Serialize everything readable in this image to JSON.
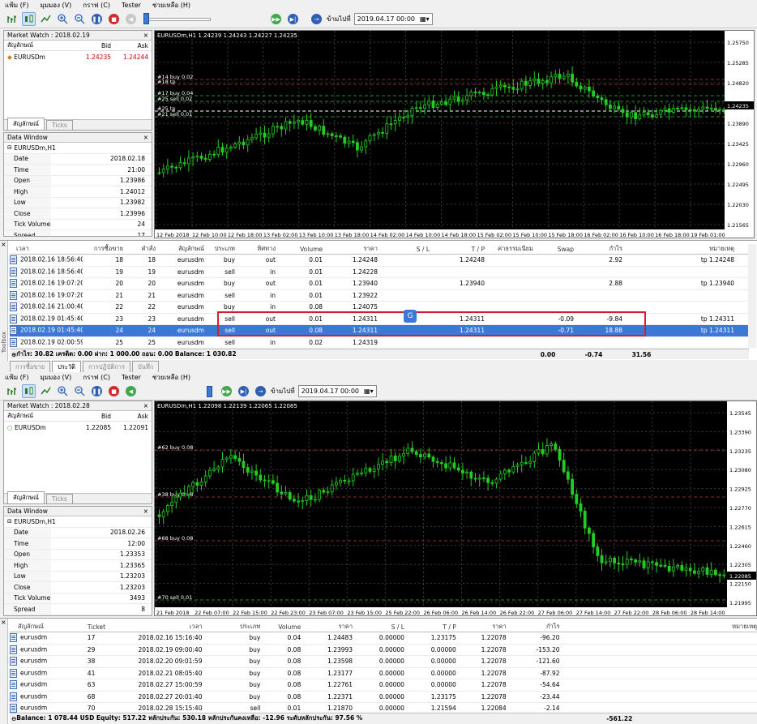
{
  "menu": [
    "แฟ้ม (F)",
    "มุมมอง (V)",
    "กราฟ (C)",
    "Tester",
    "ช่วยเหลือ (H)"
  ],
  "toolbar": {
    "goto_label": "ข้ามไปที่",
    "date": "2019.04.17 00:00"
  },
  "top": {
    "market_watch": {
      "title": "Market Watch : 2018.02.19",
      "col_symbol": "สัญลักษณ์",
      "col_bid": "Bid",
      "col_ask": "Ask",
      "symbol": "EURUSDm",
      "bid": "1.24235",
      "ask": "1.24244",
      "tab_symbols": "สัญลักษณ์",
      "tab_ticks": "Ticks"
    },
    "data_window": {
      "title": "Data Window",
      "symbol": "EURUSDm,H1",
      "rows": [
        [
          "Date",
          "2018.02.18"
        ],
        [
          "Time",
          "21:00"
        ],
        [
          "Open",
          "1.23986"
        ],
        [
          "High",
          "1.24012"
        ],
        [
          "Low",
          "1.23982"
        ],
        [
          "Close",
          "1.23996"
        ],
        [
          "Tick Volume",
          "24"
        ],
        [
          "Spread",
          "17"
        ]
      ]
    },
    "chart": {
      "header": "EURUSDm,H1  1.24239 1.24243 1.24227 1.24235",
      "prices": [
        "1.25750",
        "1.25285",
        "1.24820",
        "1.24355",
        "1.23890",
        "1.23425",
        "1.22960",
        "1.22495",
        "1.22030",
        "1.21565"
      ],
      "current": "1.24235",
      "times": [
        "12 Feb 2018",
        "12 Feb 10:00",
        "12 Feb 18:00",
        "13 Feb 02:00",
        "13 Feb 10:00",
        "13 Feb 18:00",
        "14 Feb 02:00",
        "14 Feb 10:00",
        "14 Feb 18:00",
        "15 Feb 02:00",
        "15 Feb 10:00",
        "15 Feb 18:00",
        "16 Feb 02:00",
        "16 Feb 10:00",
        "16 Feb 18:00",
        "19 Feb 01:00"
      ],
      "labels": [
        "#14 buy 0.02",
        "#18 tp",
        "#17 buy 0.04",
        "#25 sell 0.02",
        "#25 tp",
        "#21 sell 0.01"
      ]
    },
    "table": {
      "headers": [
        "เวลา",
        "การซื้อขาย",
        "คำสั่ง",
        "สัญลักษณ์",
        "ประเภท",
        "ทิศทาง",
        "Volume",
        "ราคา",
        "S / L",
        "T / P",
        "ค่าธรรมเนียม",
        "Swap",
        "กำไร",
        "หมายเหตุ"
      ],
      "rows": [
        [
          "2018.02.16 18:56:40",
          "18",
          "18",
          "eurusdm",
          "buy",
          "out",
          "0.01",
          "1.24248",
          "",
          "1.24248",
          "",
          "",
          "2.92",
          "tp 1.24248"
        ],
        [
          "2018.02.16 18:56:40",
          "19",
          "19",
          "eurusdm",
          "sell",
          "in",
          "0.01",
          "1.24228",
          "",
          "",
          "",
          "",
          "",
          ""
        ],
        [
          "2018.02.16 19:07:20",
          "20",
          "20",
          "eurusdm",
          "buy",
          "out",
          "0.01",
          "1.23940",
          "",
          "1.23940",
          "",
          "",
          "2.88",
          "tp 1.23940"
        ],
        [
          "2018.02.16 19:07:20",
          "21",
          "21",
          "eurusdm",
          "sell",
          "in",
          "0.01",
          "1.23922",
          "",
          "",
          "",
          "",
          "",
          ""
        ],
        [
          "2018.02.16 21:00:40",
          "22",
          "22",
          "eurusdm",
          "buy",
          "in",
          "0.08",
          "1.24075",
          "",
          "",
          "",
          "",
          "",
          ""
        ],
        [
          "2018.02.19 01:45:40",
          "23",
          "23",
          "eurusdm",
          "sell",
          "out",
          "0.01",
          "1.24311",
          "",
          "1.24311",
          "",
          "-0.09",
          "-9.84",
          "tp 1.24311"
        ],
        [
          "2018.02.19 01:45:40",
          "24",
          "24",
          "eurusdm",
          "sell",
          "out",
          "0.08",
          "1.24311",
          "",
          "1.24311",
          "",
          "-0.71",
          "18.88",
          "tp 1.24311"
        ],
        [
          "2018.02.19 02:00:59",
          "25",
          "25",
          "eurusdm",
          "sell",
          "in",
          "0.02",
          "1.24319",
          "",
          "",
          "",
          "",
          "",
          ""
        ]
      ],
      "summary": "กำไร: 30.82  เครดิต: 0.00  ฝาก: 1 000.00  ถอน: 0.00  Balance: 1 030.82",
      "sum_fee": "0.00",
      "sum_swap": "-0.74",
      "sum_profit": "31.56",
      "side_tab": "Toolbox",
      "tabs": [
        "การซื้อขาย",
        "ประวัติ",
        "การปฏิบัติการ",
        "บันทึก"
      ]
    }
  },
  "bottom": {
    "market_watch": {
      "title": "Market Watch : 2018.02.28",
      "col_symbol": "สัญลักษณ์",
      "col_bid": "Bid",
      "col_ask": "Ask",
      "symbol": "EURUSDm",
      "bid": "1.22085",
      "ask": "1.22091",
      "tab_symbols": "สัญลักษณ์",
      "tab_ticks": "Ticks"
    },
    "data_window": {
      "title": "Data Window",
      "symbol": "EURUSDm,H1",
      "rows": [
        [
          "Date",
          "2018.02.26"
        ],
        [
          "Time",
          "12:00"
        ],
        [
          "Open",
          "1.23353"
        ],
        [
          "High",
          "1.23365"
        ],
        [
          "Low",
          "1.23203"
        ],
        [
          "Close",
          "1.23203"
        ],
        [
          "Tick Volume",
          "3493"
        ],
        [
          "Spread",
          "8"
        ]
      ]
    },
    "chart": {
      "header": "EURUSDm,H1  1.22098 1.22139 1.22065 1.22085",
      "prices": [
        "1.23545",
        "1.23390",
        "1.23235",
        "1.23080",
        "1.22925",
        "1.22770",
        "1.22615",
        "1.22460",
        "1.22305",
        "1.22150",
        "1.21995"
      ],
      "current": "1.22085",
      "times": [
        "21 Feb 2018",
        "22 Feb 07:00",
        "22 Feb 15:00",
        "22 Feb 23:00",
        "23 Feb 07:00",
        "23 Feb 15:00",
        "25 Feb 22:00",
        "26 Feb 06:00",
        "26 Feb 14:00",
        "26 Feb 22:00",
        "27 Feb 06:00",
        "27 Feb 14:00",
        "27 Feb 22:00",
        "28 Feb 06:00",
        "28 Feb 14:00"
      ],
      "labels": [
        "#62 buy 0.08",
        "#38 buy 0.08",
        "#68 buy 0.08",
        "#70 sell 0.01"
      ]
    },
    "table": {
      "headers": [
        "สัญลักษณ์",
        "Ticket",
        "เวลา",
        "ประเภท",
        "Volume",
        "ราคา",
        "S / L",
        "T / P",
        "ราคา",
        "กำไร",
        "หมายเหตุ"
      ],
      "rows": [
        [
          "eurusdm",
          "17",
          "2018.02.16 15:16:40",
          "buy",
          "0.04",
          "1.24483",
          "0.00000",
          "1.23175",
          "1.22078",
          "-96.20",
          ""
        ],
        [
          "eurusdm",
          "29",
          "2018.02.19 09:00:40",
          "buy",
          "0.08",
          "1.23993",
          "0.00000",
          "0.00000",
          "1.22078",
          "-153.20",
          ""
        ],
        [
          "eurusdm",
          "38",
          "2018.02.20 09:01:59",
          "buy",
          "0.08",
          "1.23598",
          "0.00000",
          "0.00000",
          "1.22078",
          "-121.60",
          ""
        ],
        [
          "eurusdm",
          "41",
          "2018.02.21 08:05:40",
          "buy",
          "0.08",
          "1.23177",
          "0.00000",
          "0.00000",
          "1.22078",
          "-87.92",
          ""
        ],
        [
          "eurusdm",
          "63",
          "2018.02.27 15:00:59",
          "buy",
          "0.08",
          "1.22761",
          "0.00000",
          "0.00000",
          "1.22078",
          "-54.64",
          ""
        ],
        [
          "eurusdm",
          "68",
          "2018.02.27 20:01:40",
          "buy",
          "0.08",
          "1.22371",
          "0.00000",
          "1.23175",
          "1.22078",
          "-23.44",
          ""
        ],
        [
          "eurusdm",
          "70",
          "2018.02.28 15:15:40",
          "sell",
          "0.01",
          "1.21870",
          "0.00000",
          "1.21594",
          "1.22084",
          "-2.14",
          ""
        ]
      ],
      "summary": "Balance: 1 078.44 USD  Equity: 517.22  หลักประกัน: 530.18  หลักประกันคงเหลือ: -12.96  ระดับหลักประกัน: 97.56 %",
      "sum_profit": "-561.22"
    }
  },
  "colors": {
    "highlight": "#3b78d8",
    "box": "#d0202a",
    "bull": "#22cc22",
    "bear": "#000000"
  }
}
